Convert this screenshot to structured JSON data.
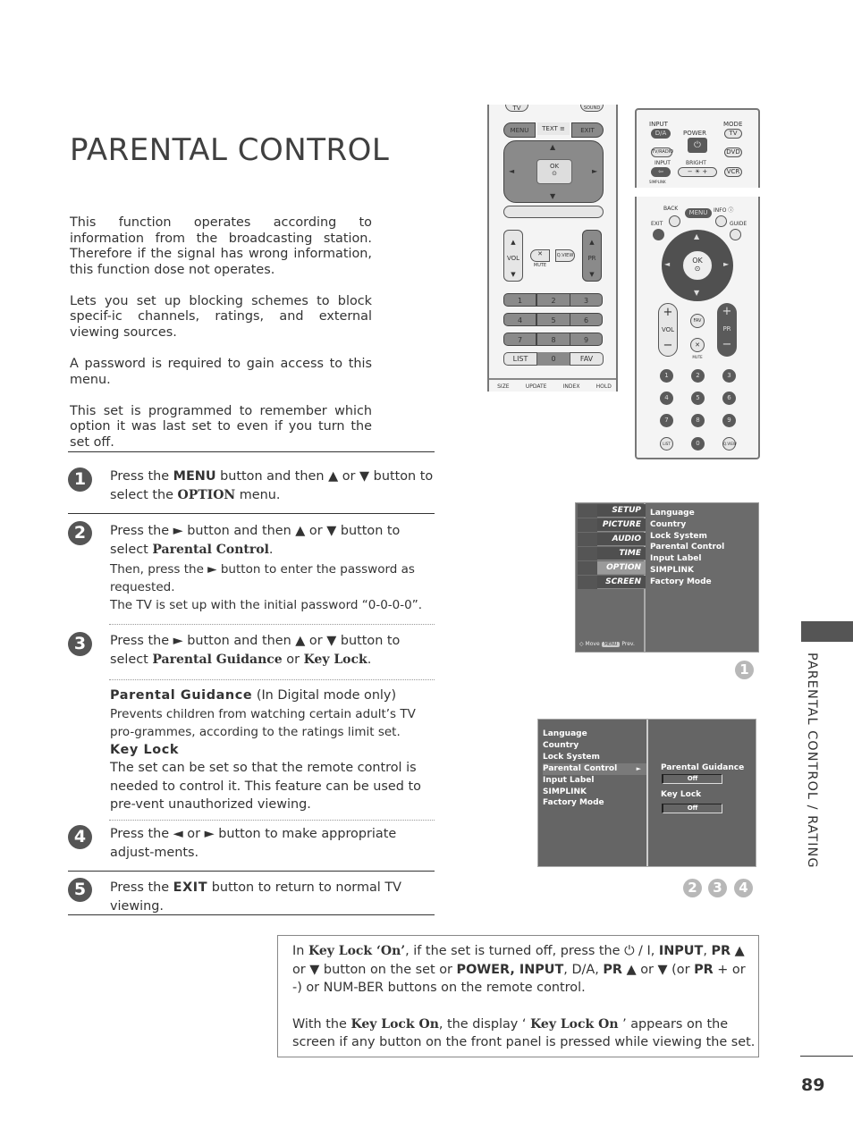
{
  "page": {
    "title": "PARENTAL CONTROL",
    "side_label": "PARENTAL CONTROL / RATING",
    "page_number": "89"
  },
  "intro": [
    "This function operates according to information from the broadcasting station. Therefore if the signal has wrong information, this function dose not operates.",
    "Lets you set up blocking schemes to block specif-ic channels, ratings, and external viewing sources.",
    "A password is required to gain access to this menu.",
    "This set is programmed to remember which option it was last set to even if you turn the set off."
  ],
  "steps": {
    "s1": {
      "num": "1",
      "a": "Press the ",
      "menu": "MENU",
      "b": " button and then ▲ or ▼ button to select the ",
      "option": "OPTION",
      "c": " menu."
    },
    "s2": {
      "num": "2",
      "a": "Press the ► button and then ▲ or ▼ button to select ",
      "target": "Parental Control",
      "b": ".",
      "c": "Then, press the ► button to enter the password as requested.",
      "d": "The TV is set up with the initial password “0-0-0-0”."
    },
    "s3": {
      "num": "3",
      "a": "Press the ► button and then ▲ or ▼ button to select ",
      "pg": "Parental Guidance",
      "or": " or ",
      "kl": "Key Lock",
      "b": "."
    },
    "pg_note": {
      "heading": "Parental Guidance",
      "qualifier": " (In Digital mode only)",
      "text": "Prevents children from watching certain adult’s TV pro-grammes, according to the ratings limit set."
    },
    "kl_note": {
      "heading": "Key Lock",
      "text": "The set can be set so that the remote control is needed to control it. This feature can be used to pre-vent unauthorized viewing."
    },
    "s4": {
      "num": "4",
      "text": "Press the ◄ or ► button to make appropriate adjust-ments."
    },
    "s5": {
      "num": "5",
      "a": "Press the ",
      "exit": "EXIT",
      "b": " button to return to normal TV viewing."
    }
  },
  "remote1": {
    "top_buttons": [
      "TV",
      "SOUND"
    ],
    "menu": "MENU",
    "text": "TEXT",
    "exit": "EXIT",
    "ok": "OK",
    "vol": "VOL",
    "pr": "PR",
    "mute": "MUTE",
    "qview": "Q.VIEW",
    "numbers": [
      "1",
      "2",
      "3",
      "4",
      "5",
      "6",
      "7",
      "8",
      "9"
    ],
    "list": "LIST",
    "zero": "0",
    "fav": "FAV",
    "bottom": [
      "SIZE",
      "UPDATE",
      "INDEX",
      "HOLD"
    ]
  },
  "remote2": {
    "input": "INPUT",
    "da": "D/A",
    "power": "POWER",
    "mode": "MODE",
    "tv": "TV",
    "tvradio": "TV/RADIO",
    "dvd": "DVD",
    "input2": "INPUT",
    "bright": "BRIGHT",
    "vcr": "VCR",
    "simplink": "SIMPLINK",
    "back": "BACK",
    "menu": "MENU",
    "info": "INFO",
    "exit": "EXIT",
    "guide": "GUIDE",
    "ok": "OK",
    "vol": "VOL",
    "fav": "FAV",
    "pr": "PR",
    "mute": "MUTE",
    "numbers": [
      "1",
      "2",
      "3",
      "4",
      "5",
      "6",
      "7",
      "8",
      "9"
    ],
    "list": "LIST",
    "zero": "0",
    "qview": "Q.VIEW"
  },
  "menu1": {
    "tabs": [
      "SETUP",
      "PICTURE",
      "AUDIO",
      "TIME",
      "OPTION",
      "SCREEN"
    ],
    "selected_tab": "OPTION",
    "items": [
      "Language",
      "Country",
      "Lock System",
      "Parental Control",
      "Input Label",
      "SIMPLINK",
      "Factory Mode"
    ],
    "footer_move": "Move",
    "footer_menu": "MENU",
    "footer_prev": "Prev."
  },
  "menu2": {
    "items": [
      "Language",
      "Country",
      "Lock System",
      "Parental Control",
      "Input Label",
      "SIMPLINK",
      "Factory Mode"
    ],
    "selected": "Parental Control",
    "sub": [
      {
        "label": "Parental Guidance",
        "value": "Off"
      },
      {
        "label": "Key Lock",
        "value": "Off"
      }
    ]
  },
  "badges": {
    "b1": "1",
    "b2": "2",
    "b3": "3",
    "b4": "4"
  },
  "note": {
    "p1": {
      "a": "In ",
      "kl": "Key Lock",
      "on": " ‘On’",
      "b": ", if the set is turned off, press the ⏻ / I, ",
      "input": "INPUT",
      "c": ", ",
      "pr": "PR",
      "d": " ▲ or ▼ button on the set or ",
      "power": "POWER, INPUT",
      "e": ", D/A, ",
      "pr2": "PR",
      "f": " ▲ or ▼ (or ",
      "pr3": "PR",
      "g": " + or -) or NUM-BER buttons on the remote control."
    },
    "p2": {
      "a": "With the ",
      "klon": "Key Lock On",
      "b": ", the display ‘ ",
      "klon2": "Key Lock On",
      "c": " ’ appears on the screen if any button on the front panel is pressed while viewing the set."
    }
  }
}
